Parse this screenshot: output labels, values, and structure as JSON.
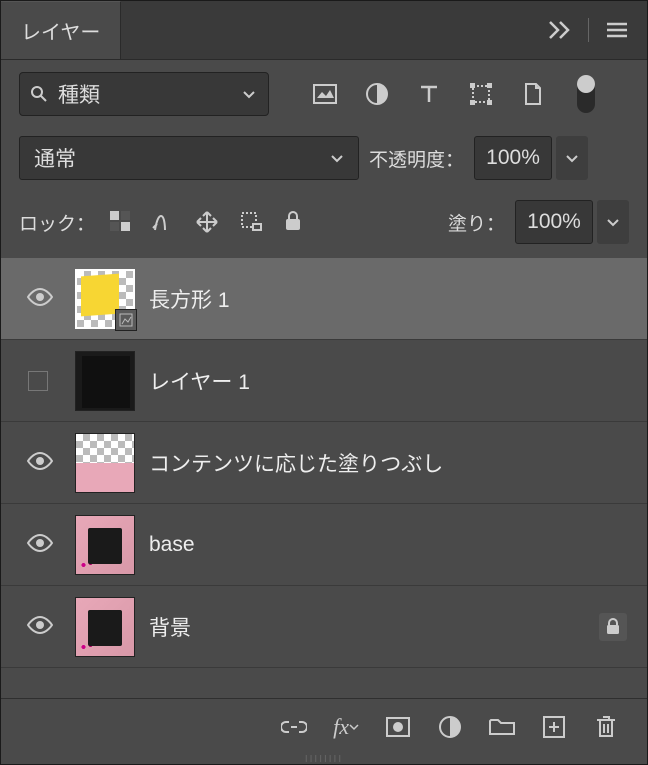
{
  "tab": {
    "title": "レイヤー"
  },
  "search": {
    "label": "種類"
  },
  "blend": {
    "mode": "通常",
    "opacity_label": "不透明度：",
    "opacity_value": "100%",
    "lock_label": "ロック：",
    "fill_label": "塗り：",
    "fill_value": "100%"
  },
  "layers": [
    {
      "name": "長方形 1",
      "visible": true,
      "selected": true,
      "thumb": "yellow-shape",
      "locked": false
    },
    {
      "name": "レイヤー 1",
      "visible": false,
      "selected": false,
      "thumb": "dark",
      "locked": false
    },
    {
      "name": "コンテンツに応じた塗りつぶし",
      "visible": true,
      "selected": false,
      "thumb": "checker-pink",
      "locked": false
    },
    {
      "name": "base",
      "visible": true,
      "selected": false,
      "thumb": "pink-photo",
      "locked": false
    },
    {
      "name": "背景",
      "visible": true,
      "selected": false,
      "thumb": "pink-photo",
      "locked": true
    }
  ]
}
